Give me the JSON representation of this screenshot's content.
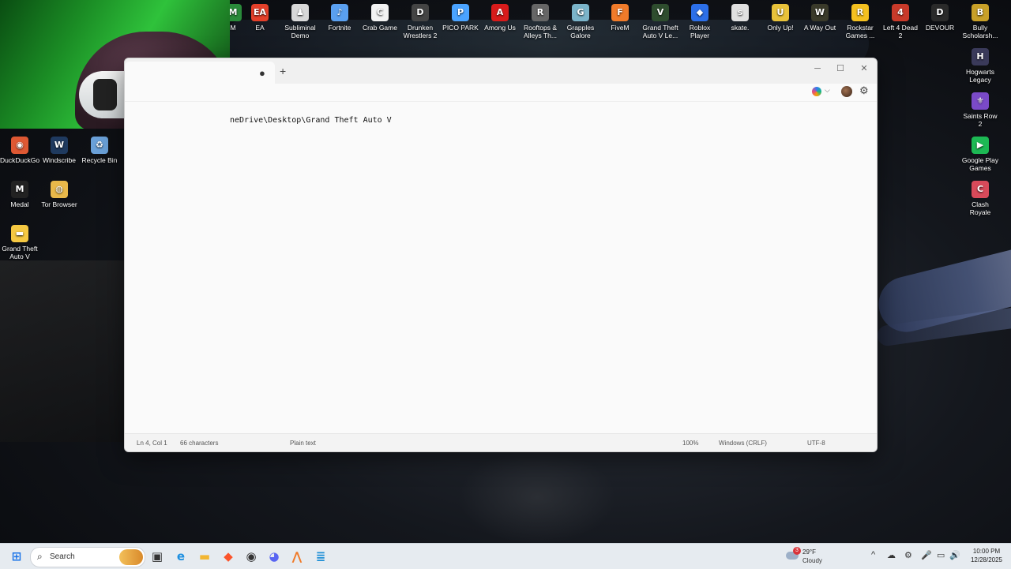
{
  "webcam": {},
  "desktop_top_icons": [
    {
      "label": "M",
      "color": "#2a8a3a",
      "glyph": "M"
    },
    {
      "label": "EA",
      "color": "#e4402a",
      "glyph": "EA"
    },
    {
      "label": "Subliminal Demo",
      "color": "#d8d8d8",
      "glyph": "♟"
    },
    {
      "label": "Fortnite",
      "color": "#5aa0f0",
      "glyph": "♪"
    },
    {
      "label": "Crab Game",
      "color": "#f2f2f2",
      "glyph": "C"
    },
    {
      "label": "Drunken Wrestlers 2",
      "color": "#444444",
      "glyph": "D"
    },
    {
      "label": "PICO PARK",
      "color": "#4aa3ff",
      "glyph": "P"
    },
    {
      "label": "Among Us",
      "color": "#d81b1b",
      "glyph": "A"
    },
    {
      "label": "Rooftops & Alleys Th...",
      "color": "#666666",
      "glyph": "R"
    },
    {
      "label": "Grapples Galore",
      "color": "#7bb4c9",
      "glyph": "G"
    },
    {
      "label": "FiveM",
      "color": "#f07b2a",
      "glyph": "F"
    },
    {
      "label": "Grand Theft Auto V Le...",
      "color": "#2e4d2e",
      "glyph": "V"
    },
    {
      "label": "Roblox Player",
      "color": "#2c6fe8",
      "glyph": "◆"
    },
    {
      "label": "skate.",
      "color": "#e0e0e0",
      "glyph": "s"
    },
    {
      "label": "Only Up!",
      "color": "#e8c23a",
      "glyph": "U"
    },
    {
      "label": "A Way Out",
      "color": "#3a3a2a",
      "glyph": "W"
    },
    {
      "label": "Rockstar Games ...",
      "color": "#f4c020",
      "glyph": "R"
    },
    {
      "label": "Left 4 Dead 2",
      "color": "#c83a2a",
      "glyph": "4"
    },
    {
      "label": "DEVOUR",
      "color": "#2a2a2a",
      "glyph": "D"
    },
    {
      "label": "Bully Scholarsh...",
      "color": "#c8a028",
      "glyph": "B"
    }
  ],
  "desktop_left_icons": [
    {
      "label": "DuckDuckGo",
      "color": "#de5833",
      "glyph": "◉"
    },
    {
      "label": "Windscribe",
      "color": "#1f3a5f",
      "glyph": "W"
    },
    {
      "label": "Recycle Bin",
      "color": "#6aa0d8",
      "glyph": "♻"
    },
    {
      "label": "Medal",
      "color": "#222222",
      "glyph": "M"
    },
    {
      "label": "Tor Browser",
      "color": "#e8b84a",
      "glyph": "◍"
    },
    {
      "label": "Grand Theft Auto V",
      "color": "#f5c842",
      "glyph": "▬"
    }
  ],
  "desktop_right_icons": [
    {
      "label": "Hogwarts Legacy",
      "color": "#3a3a5a",
      "glyph": "H"
    },
    {
      "label": "Saints Row 2",
      "color": "#7a4ac8",
      "glyph": "⚜"
    },
    {
      "label": "Google Play Games",
      "color": "#1db954",
      "glyph": "▶"
    },
    {
      "label": "Clash Royale",
      "color": "#d84a5a",
      "glyph": "C"
    }
  ],
  "notepad": {
    "tab_modified_dot": "●",
    "new_tab": "+",
    "minimize": "─",
    "maximize": "☐",
    "close": "✕",
    "settings_icon": "⚙",
    "chevron": "⌵",
    "content_line": "neDrive\\Desktop\\Grand Theft Auto V",
    "status": {
      "position": "Ln 4, Col 1",
      "characters": "66 characters",
      "format": "Plain text",
      "zoom": "100%",
      "line_ending": "Windows (CRLF)",
      "encoding": "UTF-8"
    }
  },
  "taskbar": {
    "search_placeholder": "Search",
    "weather_badge": "3",
    "temperature": "29°F",
    "condition": "Cloudy",
    "time": "10:00 PM",
    "date": "12/28/2025",
    "apps": [
      {
        "name": "start",
        "glyph": "⊞",
        "color": "#1a73e8"
      },
      {
        "name": "task-view",
        "glyph": "▣",
        "color": "#333333"
      },
      {
        "name": "edge",
        "glyph": "e",
        "color": "#1d8fe0"
      },
      {
        "name": "file-explorer",
        "glyph": "▬",
        "color": "#f2b632"
      },
      {
        "name": "brave",
        "glyph": "◆",
        "color": "#fb542b"
      },
      {
        "name": "obs",
        "glyph": "◉",
        "color": "#333333"
      },
      {
        "name": "discord",
        "glyph": "◕",
        "color": "#5865f2"
      },
      {
        "name": "fivem",
        "glyph": "⋀",
        "color": "#f07b2a"
      },
      {
        "name": "notepad",
        "glyph": "≣",
        "color": "#1f8fd6"
      }
    ],
    "tray": [
      "^",
      "☁",
      "⚙",
      "🎤",
      "▭",
      "🔊"
    ]
  }
}
